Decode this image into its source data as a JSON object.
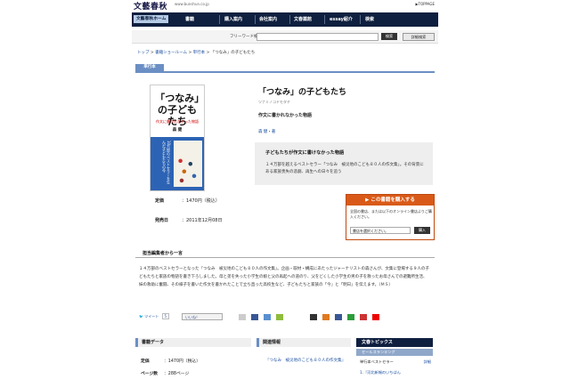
{
  "header": {
    "logo": "文藝春秋",
    "url": "www.bunshun.co.jp",
    "toppage": "▶TOPPAGE"
  },
  "nav": {
    "home": "文藝春秋ホーム",
    "section": "書籍",
    "items": [
      "購入案内",
      "会社案内",
      "文春薬館",
      "essay紹介",
      "検索"
    ]
  },
  "search": {
    "label": "フリーワード検索",
    "button": "検索",
    "advanced": "詳細検索"
  },
  "breadcrumb": [
    "トップ",
    "書籍ショールーム",
    "単行本",
    "「つなみ」の子どもたち"
  ],
  "tab": "単行本",
  "cover": {
    "title": "「つなみ」の子どもたち",
    "subtitle": "作文に書かれなかった物語",
    "author": "森 健",
    "band": "10万部のベストセラーを生んだ子どもたちの今"
  },
  "book": {
    "title": "「つなみ」の子どもたち",
    "kana": "ツナミノコドモタチ",
    "subtitle": "作文に書かれなかった物語",
    "author": "森 健・著",
    "desc_heading": "子どもたちが作文に書けなかった物語",
    "desc_text": "１４万部を越えるベストセラー「つなみ　被災地のこども８０人の作文集」。その背景にある家族喪失の悲劇、再生への日々を追う"
  },
  "specs": {
    "price_label": "定価",
    "price": "：1470円（税込）",
    "date_label": "発売日",
    "date": "：2011年12月08日"
  },
  "buy": {
    "heading": "この書籍を購入する",
    "text": "全国の書店、または以下のオンライン書店よりご購入ください。",
    "select": "書店を選択ください。",
    "go": "購入"
  },
  "editor": {
    "heading": "担当編集者から一言",
    "body": "１４万部のベストセラーとなった『つなみ　被災地のこども８０人の作文集』。企画・取材・構成にあたったジャーナリストの森さんが、文集に登場する９人の子どもたちと家族の物語を書き下ろしました。母と弟を失った小学生の娘と父の再起への道のり、父をどくした小学生の男の子を救ったお母さんでの避難所生活、妹の救助に奮闘、その様子を書いた作文を書かれたことで立ち直った高校生など、子どもたちと家族の「今」と「明日」を伝えます。（ＭＳ）"
  },
  "share": {
    "tweet": "ツイート",
    "tweet_count": "5",
    "like": "いいね！"
  },
  "book_data": {
    "heading": "書籍データ",
    "rows": [
      {
        "label": "定価",
        "value": "：1470円（税込）"
      },
      {
        "label": "ページ数",
        "value": "：288ページ"
      }
    ]
  },
  "related": {
    "heading": "関連情報",
    "link": "『つなみ　被災地のこども８０人の作文集』"
  },
  "topics": {
    "heading": "文春トピックス",
    "sub": "セールスランキング",
    "row1": "単行本ベストセラー",
    "row1_more": "詳細",
    "row2": "1.『河北新報のいちばん"
  },
  "colors": {
    "nav_bg": "#0f1f3f",
    "accent_blue": "#6b8fc4",
    "buy_orange": "#d95a18"
  }
}
